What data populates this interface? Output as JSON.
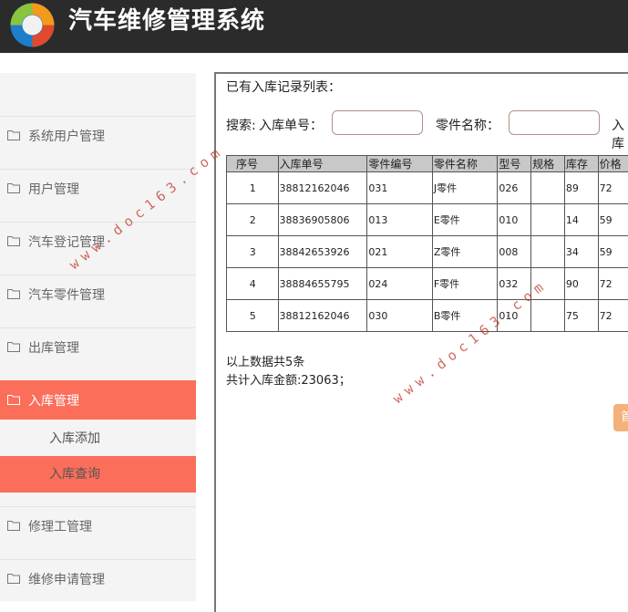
{
  "app": {
    "title": "汽车维修管理系统"
  },
  "sidebar": {
    "items": [
      {
        "label": "系统用户管理"
      },
      {
        "label": "用户管理"
      },
      {
        "label": "汽车登记管理"
      },
      {
        "label": "汽车零件管理"
      },
      {
        "label": "出库管理"
      },
      {
        "label": "入库管理",
        "active": true
      },
      {
        "label": "修理工管理"
      },
      {
        "label": "维修申请管理"
      }
    ],
    "subitems": [
      {
        "label": "入库添加"
      },
      {
        "label": "入库查询",
        "active": true
      }
    ]
  },
  "main": {
    "list_title": "已有入库记录列表：",
    "search": {
      "label": "搜索:",
      "field1_label": "入库单号：",
      "field1_value": "",
      "field2_label": "零件名称：",
      "field2_value": "",
      "field3_label": "入库"
    },
    "table": {
      "headers": [
        "序号",
        "入库单号",
        "零件编号",
        "零件名称",
        "型号",
        "规格",
        "库存",
        "价格"
      ],
      "rows": [
        [
          "1",
          "38812162046",
          "031",
          "J零件",
          "026",
          "",
          "89",
          "72"
        ],
        [
          "2",
          "38836905806",
          "013",
          "E零件",
          "010",
          "",
          "14",
          "59"
        ],
        [
          "3",
          "38842653926",
          "021",
          "Z零件",
          "008",
          "",
          "34",
          "59"
        ],
        [
          "4",
          "38884655795",
          "024",
          "F零件",
          "032",
          "",
          "90",
          "72"
        ],
        [
          "5",
          "38812162046",
          "030",
          "B零件",
          "010",
          "",
          "75",
          "72"
        ]
      ]
    },
    "summary": {
      "count_text": "以上数据共5条",
      "total_text": "共计入库金额:23063；"
    },
    "pagination": {
      "first_label": "首"
    }
  },
  "watermark": {
    "text": "www.doc163.com"
  },
  "colors": {
    "header_bg": "#2b2b2b",
    "active_bg": "#fb6e5a",
    "sidebar_bg": "#f4f4f4"
  }
}
